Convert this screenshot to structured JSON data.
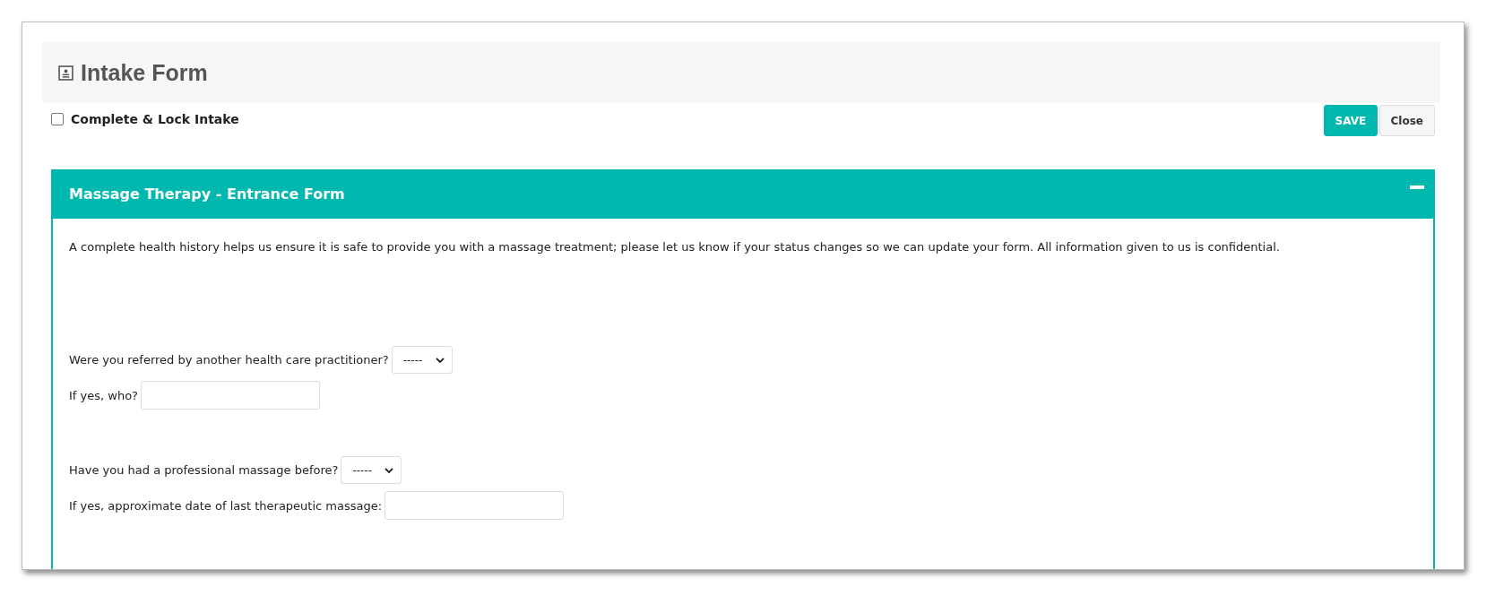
{
  "title": "Intake Form",
  "lock": {
    "label": "Complete & Lock Intake",
    "checked": false
  },
  "buttons": [
    {
      "label": "SAVE",
      "kind": "primary"
    },
    {
      "label": "Close",
      "kind": "default"
    }
  ],
  "panel": {
    "title": "Massage Therapy - Entrance Form",
    "expanded": true,
    "description": "A complete health history helps us ensure it is safe to provide you with a massage treatment; please let us know if your status changes so we can update your form. All information given to us is confidential.",
    "questions": [
      {
        "label": "Were you referred by another health care practitioner?",
        "kind": "select",
        "value": "-----"
      },
      {
        "label": "If yes, who?",
        "kind": "text"
      },
      {
        "label": "Have you had a professional massage before?",
        "kind": "select",
        "value": "-----"
      },
      {
        "label": "If yes, approximate date of last therapeutic massage:",
        "kind": "text"
      }
    ]
  }
}
